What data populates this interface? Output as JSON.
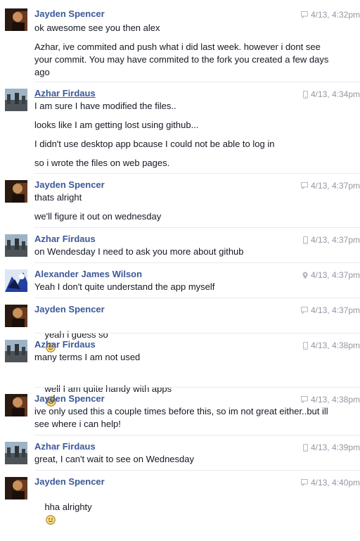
{
  "messages": [
    {
      "sender": "Jayden Spencer",
      "time": "4/13, 4:32pm",
      "device": "chat-icon",
      "lines": [
        "ok awesome see you then alex",
        "Azhar, ive commited and push what i did last week. however i dont see your commit. You may have commited to the fork you created a few days ago"
      ]
    },
    {
      "sender": "Azhar Firdaus",
      "time": "4/13, 4:34pm",
      "device": "mobile-icon",
      "lines": [
        "I am sure I have modified the files..",
        "looks like I am getting lost using github...",
        "I didn't use desktop app bcause I could not be able to log in",
        "so i wrote the files on web pages."
      ]
    },
    {
      "sender": "Jayden Spencer",
      "time": "4/13, 4:37pm",
      "device": "chat-icon",
      "lines": [
        "thats alright",
        "we'll figure it out on wednesday"
      ]
    },
    {
      "sender": "Azhar Firdaus",
      "time": "4/13, 4:37pm",
      "device": "mobile-icon",
      "lines": [
        "on Wendesday I need to ask you more about github"
      ]
    },
    {
      "sender": "Alexander James Wilson",
      "time": "4/13, 4:37pm",
      "device": "location-icon",
      "lines": [
        "Yeah I don't quite understand the app myself"
      ]
    },
    {
      "sender": "Jayden Spencer",
      "time": "4/13, 4:37pm",
      "device": "chat-icon",
      "lines": [
        "yeah i guess so"
      ]
    },
    {
      "sender": "Azhar Firdaus",
      "time": "4/13, 4:38pm",
      "device": "mobile-icon",
      "lines": [
        "many terms I am not used",
        "well I am quite handy with apps"
      ]
    },
    {
      "sender": "Jayden Spencer",
      "time": "4/13, 4:38pm",
      "device": "chat-icon",
      "lines": [
        "ive only used this a couple times before this, so im not great either..but ill see where i can help!"
      ]
    },
    {
      "sender": "Azhar Firdaus",
      "time": "4/13, 4:39pm",
      "device": "mobile-icon",
      "lines": [
        "great, I can't wait to see on Wednesday"
      ]
    },
    {
      "sender": "Jayden Spencer",
      "time": "4/13, 4:40pm",
      "device": "chat-icon",
      "lines": [
        "hha alrighty"
      ]
    }
  ]
}
